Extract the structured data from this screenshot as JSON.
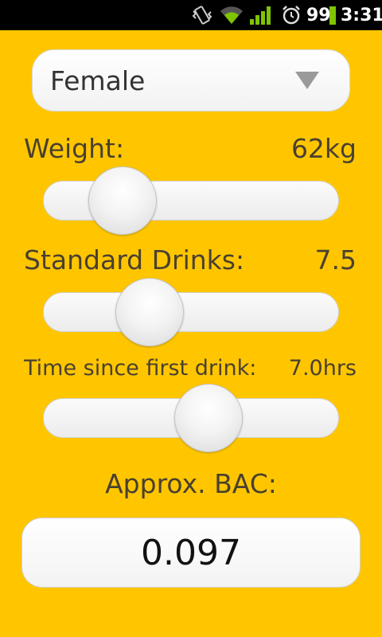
{
  "status_bar": {
    "icons": [
      "vibrate-icon",
      "wifi-icon",
      "signal-icon",
      "alarm-icon",
      "battery-icon"
    ],
    "battery_level": "99",
    "time": "3:31"
  },
  "gender": {
    "selected": "Female"
  },
  "weight": {
    "label": "Weight:",
    "value": "62kg",
    "slider_fraction": 0.27
  },
  "drinks": {
    "label": "Standard Drinks:",
    "value": "7.5",
    "slider_fraction": 0.36
  },
  "time_since": {
    "label": "Time since first drink:",
    "value": "7.0hrs",
    "slider_fraction": 0.56
  },
  "bac": {
    "label": "Approx. BAC:",
    "value": "0.097"
  },
  "colors": {
    "background": "#FFC600",
    "text": "#4A4030"
  }
}
